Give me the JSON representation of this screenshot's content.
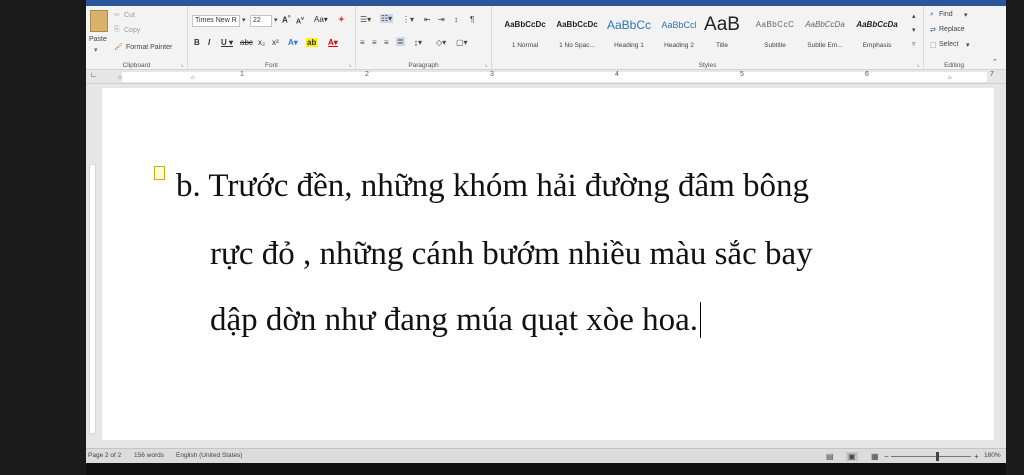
{
  "ribbon": {
    "clipboard": {
      "paste": "Paste",
      "cut": "Cut",
      "copy": "Copy",
      "format_painter": "Format Painter",
      "label": "Clipboard"
    },
    "font": {
      "name": "Times New R",
      "size": "22",
      "label": "Font"
    },
    "paragraph": {
      "label": "Paragraph"
    },
    "styles": {
      "label": "Styles",
      "items": [
        {
          "preview": "AaBbCcDc",
          "name": "1 Normal"
        },
        {
          "preview": "AaBbCcDc",
          "name": "1 No Spac..."
        },
        {
          "preview": "AaBbCc",
          "name": "Heading 1"
        },
        {
          "preview": "AaBbCcl",
          "name": "Heading 2"
        },
        {
          "preview": "AaB",
          "name": "Title"
        },
        {
          "preview": "AaBbCcC",
          "name": "Subtitle"
        },
        {
          "preview": "AaBbCcDa",
          "name": "Subtle Em..."
        },
        {
          "preview": "AaBbCcDa",
          "name": "Emphasis"
        }
      ]
    },
    "editing": {
      "find": "Find",
      "replace": "Replace",
      "select": "Select",
      "label": "Editing"
    }
  },
  "ruler": {
    "numbers": [
      "1",
      "2",
      "3",
      "4",
      "5",
      "6",
      "7"
    ]
  },
  "document": {
    "line1": "b. Trước đền, những khóm hải đường đâm bông",
    "line2": "rực đỏ , những cánh bướm nhiều màu sắc bay",
    "line3": "dập dờn như đang múa quạt xòe hoa."
  },
  "status": {
    "page": "Page 2 of 2",
    "words": "156 words",
    "language": "English (United States)",
    "zoom": "180%"
  }
}
